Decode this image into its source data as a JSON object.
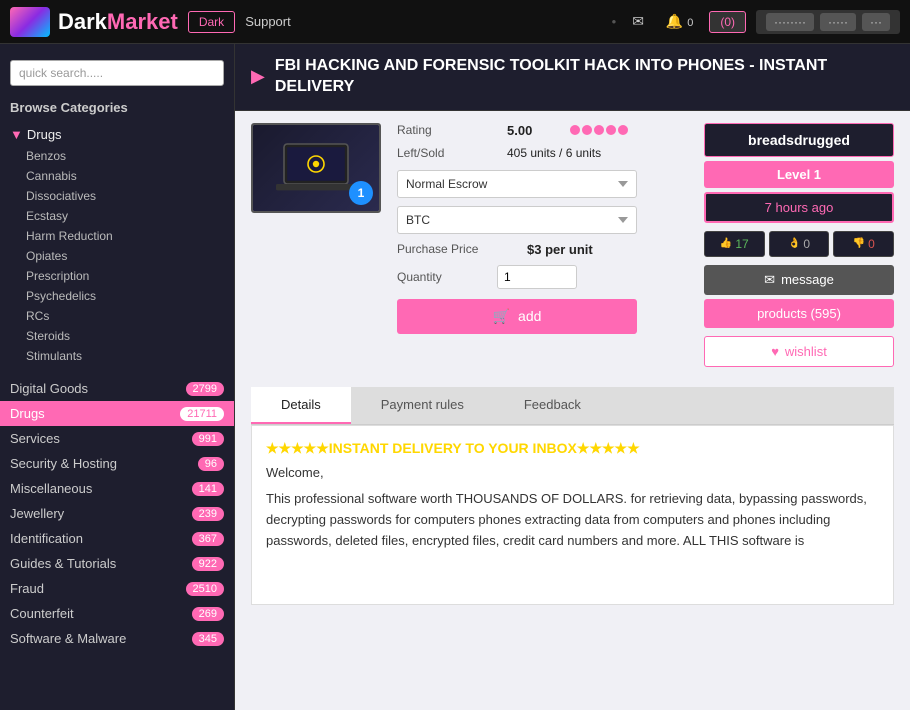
{
  "header": {
    "logo_dark": "Dark",
    "logo_market": "Market",
    "btn_dark": "Dark",
    "btn_support": "Support",
    "cart_label": "(0)",
    "nav_items": [
      "messages",
      "notifications",
      "cart"
    ]
  },
  "search": {
    "placeholder": "quick search....."
  },
  "sidebar": {
    "browse_title": "Browse Categories",
    "drugs_label": "Drugs",
    "drug_children": [
      "Benzos",
      "Cannabis",
      "Dissociatives",
      "Ecstasy",
      "Harm Reduction",
      "Opiates",
      "Prescription",
      "Psychedelics",
      "RCs",
      "Steroids",
      "Stimulants"
    ],
    "categories": [
      {
        "name": "Digital Goods",
        "count": "2799"
      },
      {
        "name": "Drugs",
        "count": "21711",
        "active": true
      },
      {
        "name": "Services",
        "count": "991"
      },
      {
        "name": "Security & Hosting",
        "count": "96"
      },
      {
        "name": "Miscellaneous",
        "count": "141"
      },
      {
        "name": "Jewellery",
        "count": "239"
      },
      {
        "name": "Identification",
        "count": "367"
      },
      {
        "name": "Guides & Tutorials",
        "count": "922"
      },
      {
        "name": "Fraud",
        "count": "2510"
      },
      {
        "name": "Counterfeit",
        "count": "269"
      },
      {
        "name": "Software & Malware",
        "count": "345"
      }
    ]
  },
  "product": {
    "title": "FBI HACKING AND FORENSIC TOOLKIT HACK INTO PHONES - INSTANT DELIVERY",
    "rating_label": "Rating",
    "rating_value": "5.00",
    "dots": 5,
    "leftsold_label": "Left/Sold",
    "left_units": "405 units",
    "sold_units": "6 units",
    "escrow_option": "Normal Escrow",
    "currency_option": "BTC",
    "price_label": "Purchase Price",
    "price_value": "$3 per unit",
    "quantity_label": "Quantity",
    "quantity_value": "1",
    "add_label": "add",
    "circle_badge": "1"
  },
  "seller": {
    "name": "breadsdrugged",
    "level": "Level 1",
    "time_ago": "7 hours ago",
    "stat_pos": "17",
    "stat_neu": "0",
    "stat_neg": "0",
    "msg_label": "message",
    "products_label": "products (595)",
    "wishlist_label": "wishlist"
  },
  "tabs": {
    "items": [
      "Details",
      "Payment rules",
      "Feedback"
    ],
    "active": "Details"
  },
  "description": {
    "stars": "★★★★★INSTANT DELIVERY TO YOUR INBOX★★★★★",
    "welcome": "Welcome,",
    "body": "This professional software worth THOUSANDS OF DOLLARS. for retrieving data, bypassing passwords, decrypting passwords for computers phones extracting data from computers and phones including passwords, deleted files, encrypted files, credit card numbers and more. ALL THIS software is"
  }
}
